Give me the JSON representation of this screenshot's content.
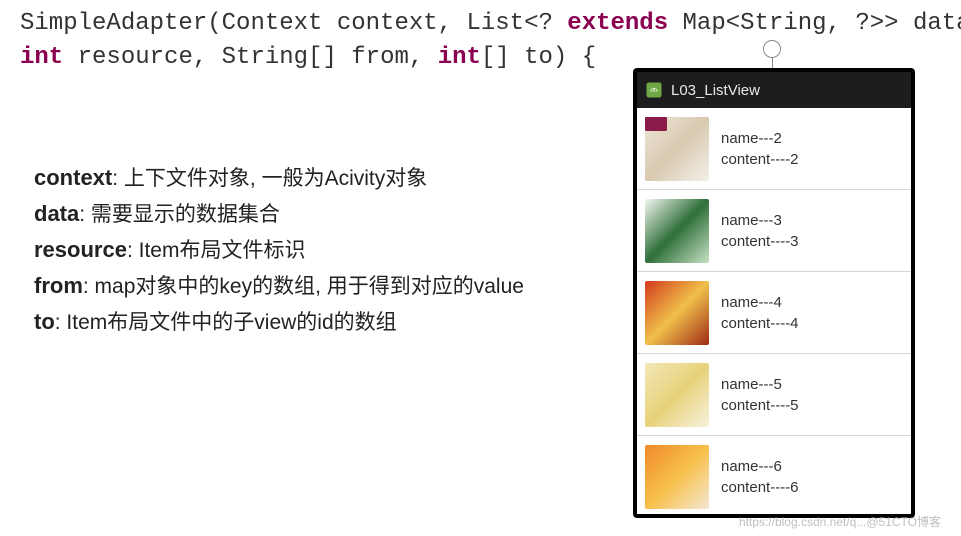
{
  "code": {
    "line1": {
      "t1": "SimpleAdapter(Context context, List<? ",
      "kw_extends": "extends",
      "t2": " Map<String, ?>> data,"
    },
    "line2": {
      "sp": " ",
      "kw_int1": "int",
      "t1": " resource, String[] from, ",
      "kw_int2": "int",
      "t2": "[] to) {"
    }
  },
  "explain": {
    "context": {
      "label": "context",
      "desc": ": 上下文件对象, 一般为Acivity对象"
    },
    "data": {
      "label": "data",
      "desc": ": 需要显示的数据集合"
    },
    "resource": {
      "label": "resource",
      "desc": ": Item布局文件标识"
    },
    "from": {
      "label": "from",
      "desc": ": map对象中的key的数组, 用于得到对应的value"
    },
    "to": {
      "label": "to",
      "desc": ": Item布局文件中的子view的id的数组"
    }
  },
  "phone": {
    "title": "L03_ListView",
    "rows": [
      {
        "name": "name---2",
        "content": "content----2",
        "colors": [
          "#efe7da",
          "#d8c9b0",
          "#f3f0e9"
        ],
        "hasBadge": true
      },
      {
        "name": "name---3",
        "content": "content----3",
        "colors": [
          "#f3f7ef",
          "#2f6f3a",
          "#c7e2c4"
        ],
        "hasBadge": false
      },
      {
        "name": "name---4",
        "content": "content----4",
        "colors": [
          "#d23a1e",
          "#f0c04a",
          "#9e2a14"
        ],
        "hasBadge": false
      },
      {
        "name": "name---5",
        "content": "content----5",
        "colors": [
          "#f2e7b8",
          "#e7d27a",
          "#f7f3dd"
        ],
        "hasBadge": false
      },
      {
        "name": "name---6",
        "content": "content----6",
        "colors": [
          "#f08a2a",
          "#f7c04a",
          "#f3e8d2"
        ],
        "hasBadge": false
      }
    ]
  },
  "watermark": "https://blog.csdn.net/q...@51CTO博客"
}
